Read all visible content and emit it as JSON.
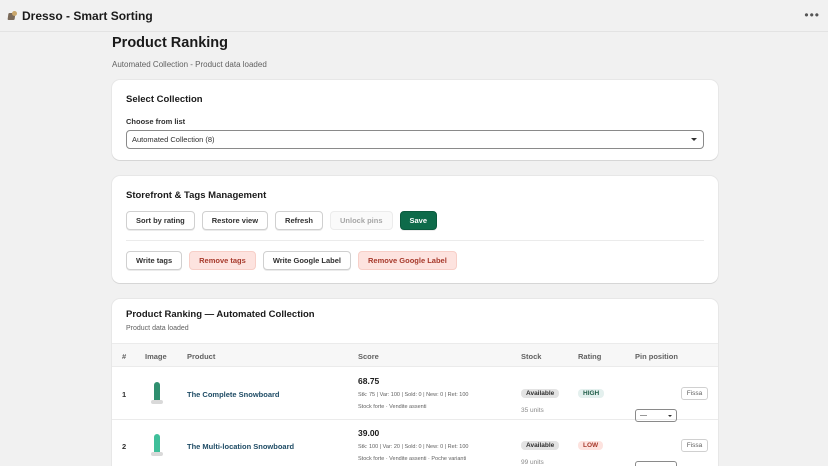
{
  "app": {
    "title": "Dresso - Smart Sorting",
    "icon": "app-logo-icon",
    "menu_icon": "more-horizontal-icon"
  },
  "page": {
    "title": "Product Ranking",
    "subtitle": "Automated Collection - Product data loaded"
  },
  "select_collection": {
    "title": "Select Collection",
    "label": "Choose from list",
    "selected": "Automated Collection (8)"
  },
  "storefront": {
    "title": "Storefront & Tags Management",
    "row1": [
      "Sort by rating",
      "Restore view",
      "Refresh",
      "Unlock pins",
      "Save"
    ],
    "row2": [
      "Write tags",
      "Remove tags",
      "Write Google Label",
      "Remove Google Label"
    ]
  },
  "ranking": {
    "title": "Product Ranking — Automated Collection",
    "subtitle": "Product data loaded",
    "columns": [
      "#",
      "Image",
      "Product",
      "Score",
      "Stock",
      "Rating",
      "Pin position"
    ],
    "rows": [
      {
        "num": "1",
        "product": "The Complete Snowboard",
        "score": "68.75",
        "score_detail": "Stk: 75 | Var: 100 | Sold: 0 | New: 0 | Ret: 100",
        "score_notes": "Stock forte · Vendite assenti",
        "stock_badge": "Available",
        "stock_units": "35 units",
        "rating": "HIGH",
        "pin_value": "—",
        "pin_button": "Fissa",
        "thumb_color": "#2f8f6f"
      },
      {
        "num": "2",
        "product": "The Multi-location Snowboard",
        "score": "39.00",
        "score_detail": "Stk: 100 | Var: 20 | Sold: 0 | New: 0 | Ret: 100",
        "score_notes": "Stock forte · Vendite assenti · Poche varianti",
        "stock_badge": "Available",
        "stock_units": "99 units",
        "rating": "LOW",
        "pin_value": "—",
        "pin_button": "Fissa",
        "thumb_color": "#3fbf9a"
      }
    ]
  }
}
